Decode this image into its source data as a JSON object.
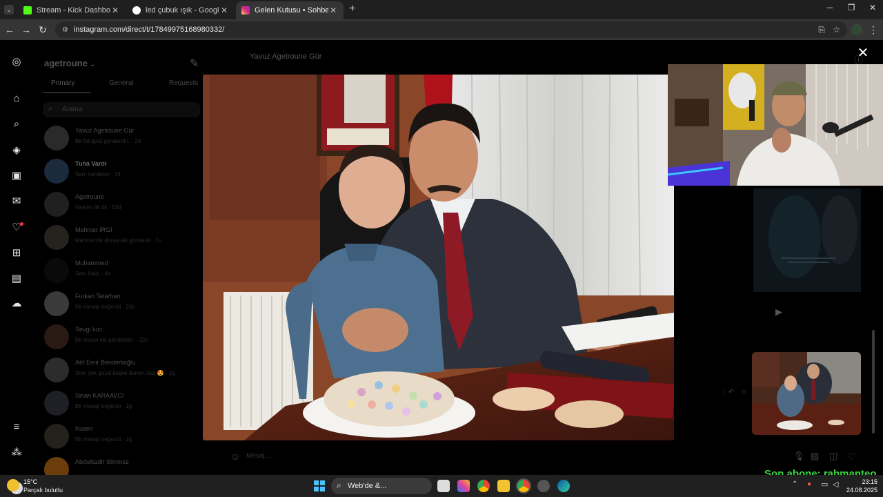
{
  "browser": {
    "tabs": [
      {
        "title": "Stream - Kick Dashboard",
        "favicon_color": "#53fc18",
        "active": false
      },
      {
        "title": "led çubuk ışık - Google'da Ara",
        "favicon_color": "#ffffff",
        "active": false
      },
      {
        "title": "Gelen Kutusu • Sohbetler",
        "favicon_color": "#d62976",
        "active": true
      }
    ],
    "new_tab": "+",
    "url": "instagram.com/direct/t/17849975168980332/"
  },
  "instagram": {
    "account": "agetroune",
    "subtabs": [
      "Primary",
      "General",
      "Requests"
    ],
    "search_placeholder": "Arama",
    "conversations": [
      {
        "name": "Yavuz Agetroune Gür",
        "preview": "Bir fotoğraf gönderdin. · 2d",
        "avatar_color": "#2a2a2a"
      },
      {
        "name": "Tuna Varol",
        "preview": "Sen: nerdesin · 7d",
        "avatar_color": "#1c2a3e"
      },
      {
        "name": "Agetroune",
        "preview": "Gelyim 4k 4k · 53d",
        "avatar_color": "#202020"
      },
      {
        "name": "Mehmet İRGİ",
        "preview": "Mehmet bir dosya eki gönderdi · 1s",
        "avatar_color": "#26221e"
      },
      {
        "name": "Muhammed",
        "preview": "Sen: haklı · 4s",
        "avatar_color": "#0a0a0a"
      },
      {
        "name": "Furkan Tatarhan",
        "preview": "Bir mesajı beğendi · 20s",
        "avatar_color": "#3a3a3a"
      },
      {
        "name": "Sevgi kızı",
        "preview": "Bir dosya eki gönderdin. · 32s",
        "avatar_color": "#2a1a14"
      },
      {
        "name": "Atıf Emir Benderlioğlu",
        "preview": "Sen: çok güzel keşke benim olsa 😍 · 2g",
        "avatar_color": "#2c2c2c"
      },
      {
        "name": "Sinan KARAAVCI",
        "preview": "Bir mesajı beğendi · 2g",
        "avatar_color": "#1f1f26"
      },
      {
        "name": "Kuzen",
        "preview": "Bir mesajı beğendi · 2g",
        "avatar_color": "#24201a"
      },
      {
        "name": "Abdulkadir Sönmez",
        "preview": "",
        "avatar_color": "#6b3d0a"
      }
    ],
    "chat_title": "Yavuz Agetroune Gür",
    "composer_placeholder": "Mesaj..."
  },
  "viewer": {
    "close": "✕"
  },
  "overlay": {
    "sub_alert": "Son abone: rahmanteo"
  },
  "taskbar": {
    "weather_temp": "15°C",
    "weather_desc": "Parçalı bulutlu",
    "search_label": "Web'de &...",
    "time": "23:15",
    "date": "24.08.2025"
  }
}
